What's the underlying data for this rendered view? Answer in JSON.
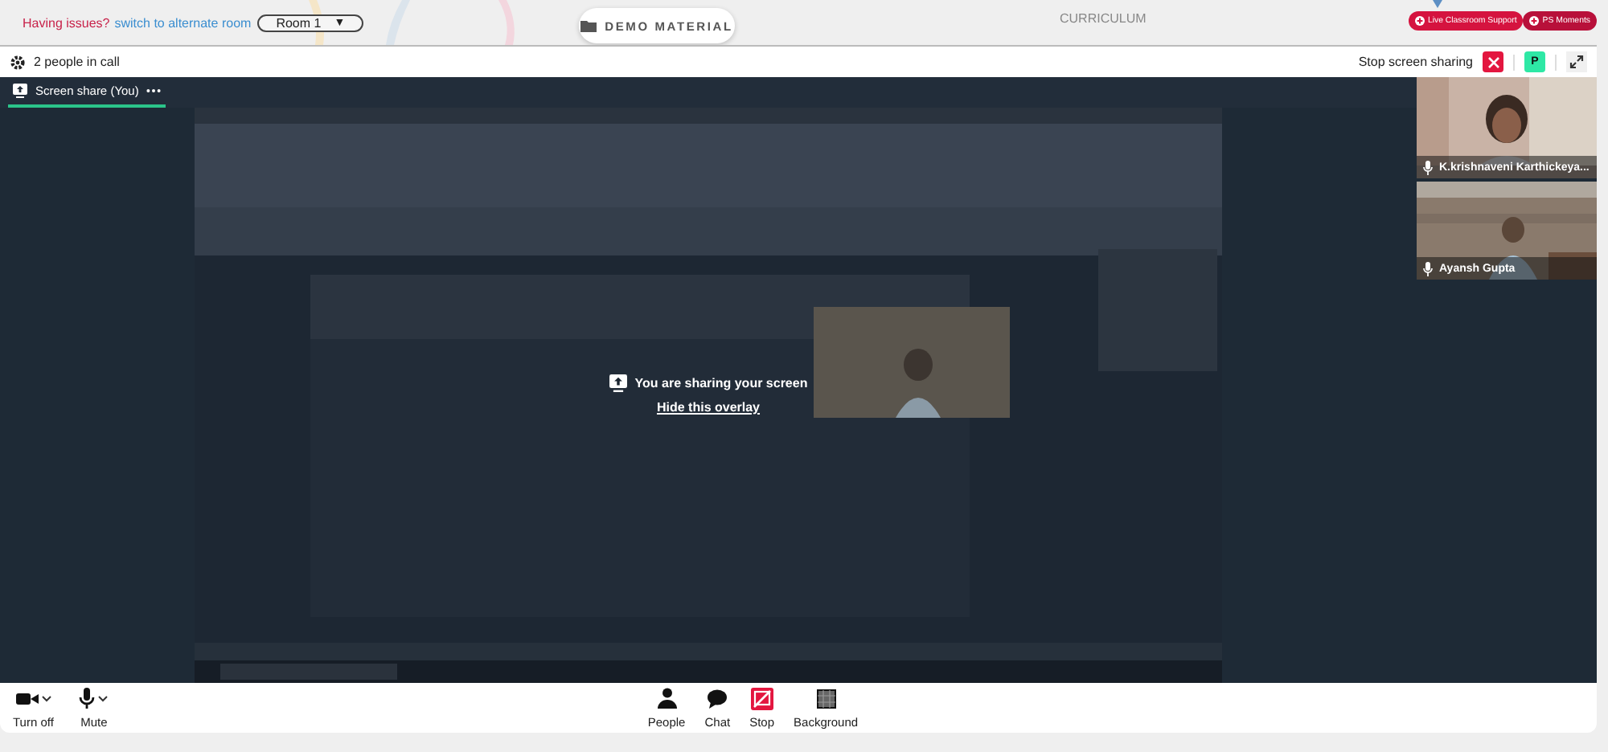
{
  "top_bar": {
    "issue_text": "Having issues?",
    "switch_link": "switch to alternate room",
    "room_select": "Room 1",
    "room_caret": "▼",
    "demo_button": "DEMO MATERIAL",
    "curriculum_tab": "CURRICULUM",
    "badges": [
      "Live Classroom Support",
      "PS Moments"
    ]
  },
  "call_header": {
    "people_count": "2 people in call",
    "stop_label": "Stop screen sharing",
    "avatar_letter": "P"
  },
  "tabs": [
    {
      "label": "Screen share (You)",
      "selected": true
    }
  ],
  "overlay": {
    "message": "You are sharing your screen",
    "hide_link": "Hide this overlay"
  },
  "participants": [
    {
      "name": "K.krishnaveni Karthickeya..."
    },
    {
      "name": "Ayansh Gupta"
    }
  ],
  "controls_left": [
    {
      "label": "Turn off",
      "kind": "camera"
    },
    {
      "label": "Mute",
      "kind": "mic"
    }
  ],
  "controls_center": [
    {
      "label": "People",
      "kind": "people"
    },
    {
      "label": "Chat",
      "kind": "chat"
    },
    {
      "label": "Stop",
      "kind": "stop"
    },
    {
      "label": "Background",
      "kind": "background"
    }
  ]
}
